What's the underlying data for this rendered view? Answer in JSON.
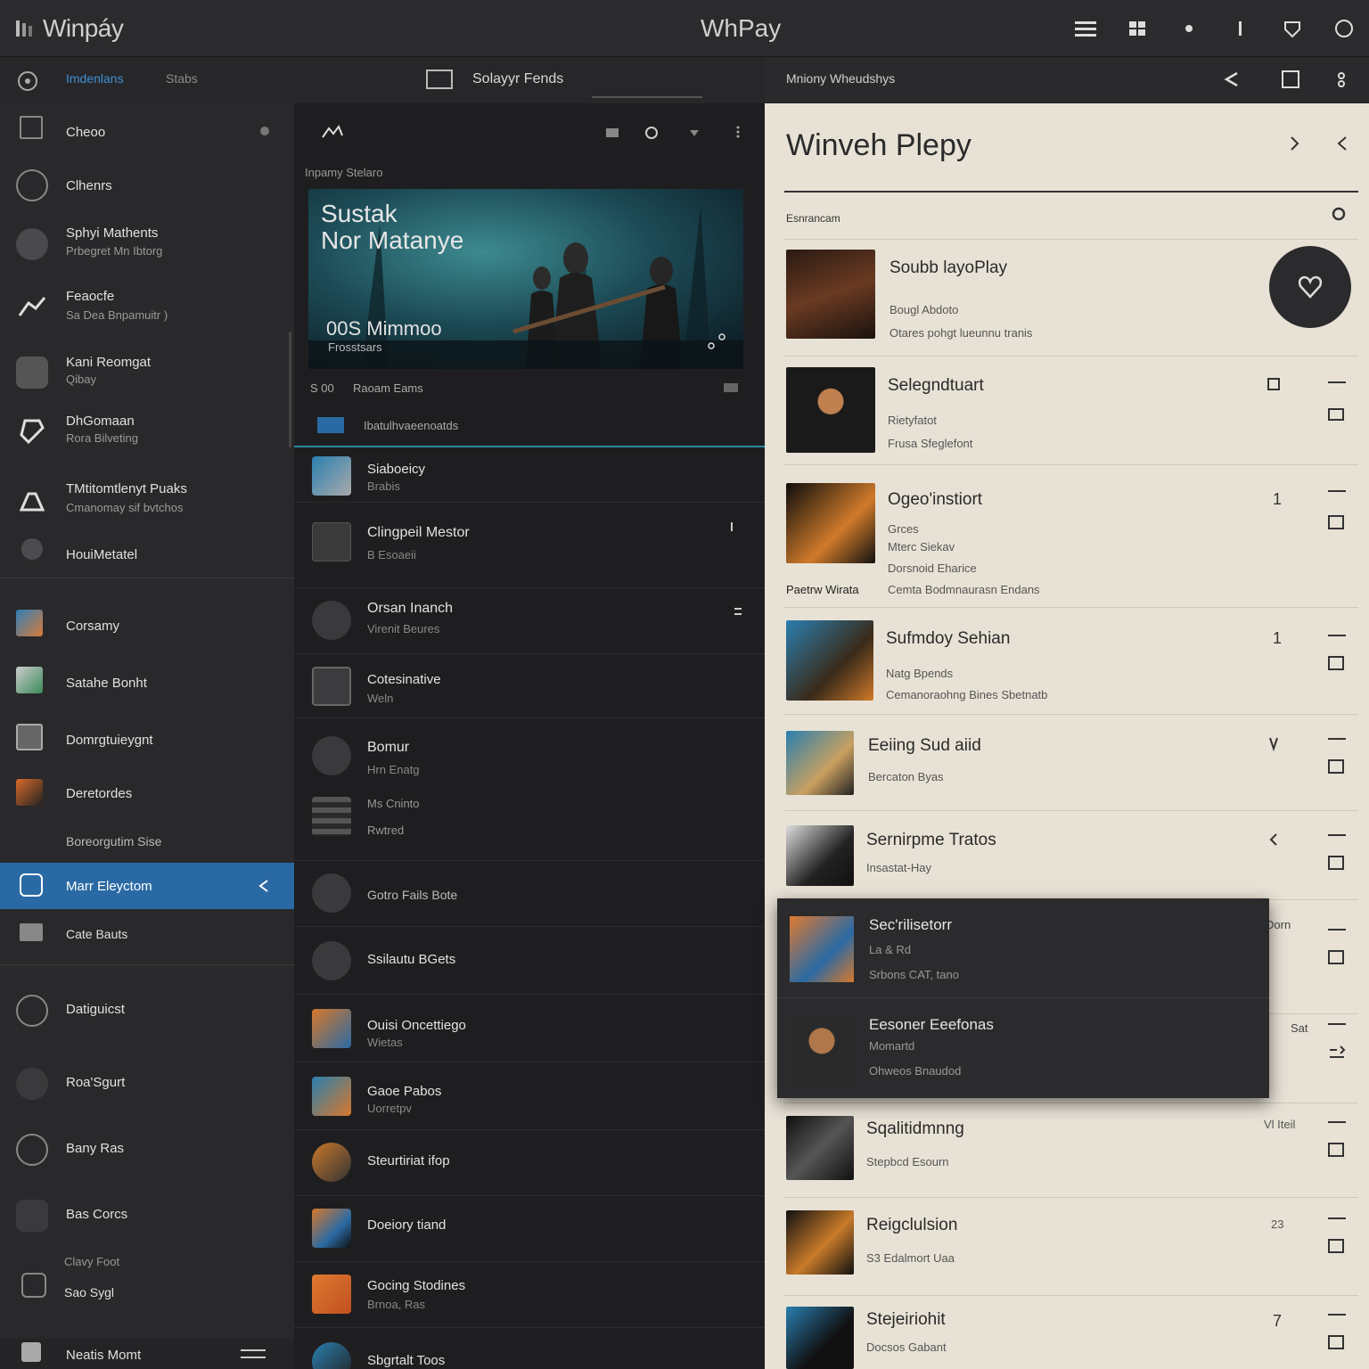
{
  "app": {
    "brand": "Winpáy",
    "window_title": "WhPay"
  },
  "subbar": {
    "tab_active": "Imdenlans",
    "tab_2": "Stabs",
    "center_label": "Solayyr Fends",
    "right_label": "Mniony Wheudshys"
  },
  "sidebar": {
    "items": [
      {
        "title": "Cheoo",
        "sub": ""
      },
      {
        "title": "Clhenrs",
        "sub": ""
      },
      {
        "title": "Sphyi Mathents",
        "sub": "Prbegret Mn Ibtorg"
      },
      {
        "title": "Feaocfe",
        "sub": "Sa Dea Bnpamuitr )"
      },
      {
        "title": "Kani Reomgat",
        "sub": "Qibay"
      },
      {
        "title": "DhGomaan",
        "sub": "Rora Bilveting"
      },
      {
        "title": "TMtitomtlenyt Puaks",
        "sub": "Cmanomay sif bvtchos"
      },
      {
        "title": "HouiMetatel",
        "sub": ""
      },
      {
        "title": "Corsamy",
        "sub": ""
      },
      {
        "title": "Satahe Bonht",
        "sub": ""
      },
      {
        "title": "Domrgtuieygnt",
        "sub": ""
      },
      {
        "title": "Deretordes",
        "sub": ""
      },
      {
        "title": "Boreorgutim Sise",
        "sub": ""
      },
      {
        "title": "Marr Eleyctom",
        "sub": ""
      },
      {
        "title": "Cate Bauts",
        "sub": ""
      },
      {
        "title": "Datiguicst",
        "sub": ""
      },
      {
        "title": "Roa'Sgurt",
        "sub": ""
      },
      {
        "title": "Bany Ras",
        "sub": ""
      },
      {
        "title": "Bas Corcs",
        "sub": ""
      },
      {
        "title": "Clavy Foot",
        "sub": ""
      },
      {
        "title": "Sao Sygl",
        "sub": ""
      },
      {
        "title": "Neatis Momt",
        "sub": ""
      }
    ]
  },
  "middle": {
    "section_label": "Inpamy Stelaro",
    "hero": {
      "title_line1": "Sustak",
      "title_line2": "Nor Matanye",
      "subtitle": "00S Mimmoo",
      "caption": "Frosstsars"
    },
    "meta_left": "S 00",
    "meta_right": "Raoam Eams",
    "selected_bar": "Ibatulhvaeenoatds",
    "rows": [
      {
        "title": "Siaboeicy",
        "sub": "Brabis"
      },
      {
        "title": "Clingpeil Mestor",
        "sub": "B Esoaeii"
      },
      {
        "title": "Orsan Inanch",
        "sub": "Virenit Beures"
      },
      {
        "title": "Cotesinative",
        "sub": "Weln"
      },
      {
        "title": "Bomur",
        "sub": "Hrn Enatg"
      },
      {
        "title": "Ms Cninto",
        "sub": "Rwtred"
      },
      {
        "title": "Gotro Fails Bote",
        "sub": ""
      },
      {
        "title": "Ssilautu BGets",
        "sub": ""
      },
      {
        "title": "Ouisi Oncettiego",
        "sub": "Wietas"
      },
      {
        "title": "Gaoe Pabos",
        "sub": "Uorretpv"
      },
      {
        "title": "Steurtiriat ifop",
        "sub": ""
      },
      {
        "title": "Doeiory tiand",
        "sub": ""
      },
      {
        "title": "Gocing Stodines",
        "sub": "Brnoa, Ras"
      },
      {
        "title": "Sbgrtalt Toos",
        "sub": ""
      }
    ]
  },
  "right": {
    "title": "Winveh Plepy",
    "section": "Esnrancam",
    "rows": [
      {
        "title": "Soubb layoPlay",
        "sub1": "Bougl Abdoto",
        "sub2": "Otares pohgt lueunnu tranis",
        "num": ""
      },
      {
        "title": "Selegndtuart",
        "sub1": "Rietyfatot",
        "sub2": "Frusa Sfeglefont",
        "num": ""
      },
      {
        "title": "Ogeo'instiort",
        "sub1": "Grces",
        "sub2": "Mterc Siekav",
        "sub3": "Dorsnoid Eharice",
        "extra": "Paetrw Wirata",
        "extra2": "Cemta Bodmnaurasn Endans",
        "num": "1"
      },
      {
        "title": "Sufmdoy Sehian",
        "sub1": "Natg Bpends",
        "sub2": "Cemanoraohng Bines Sbetnatb",
        "num": "1"
      },
      {
        "title": "Eeiing Sud aiid",
        "sub1": "Bercaton Byas",
        "sub2": "",
        "num": ""
      },
      {
        "title": "Sernirpme Tratos",
        "sub1": "Insastat-Hay",
        "sub2": "",
        "num": ""
      },
      {
        "title": "Sqalitidmnng",
        "sub1": "Stepbcd Esourn",
        "sub2": "",
        "num": "Vl Iteil"
      },
      {
        "title": "Reigclulsion",
        "sub1": "S3 Edalmort Uaa",
        "sub2": "",
        "num": "23"
      },
      {
        "title": "Stejeiriohit",
        "sub1": "Docsos Gabant",
        "sub2": "",
        "num": "7"
      }
    ],
    "popup": [
      {
        "title": "Sec'rilisetorr",
        "sub1": "La & Rd",
        "sub2": "Srbons CAT, tano",
        "badge": "Dorn"
      },
      {
        "title": "Eesoner Eeefonas",
        "sub1": "Momartd",
        "sub2": "Ohweos Bnaudod",
        "badge": "Sat"
      }
    ]
  },
  "colors": {
    "active_blue": "#2a6aa4",
    "accent_teal": "#1e8a9a",
    "right_bg": "#e8e2d6"
  }
}
